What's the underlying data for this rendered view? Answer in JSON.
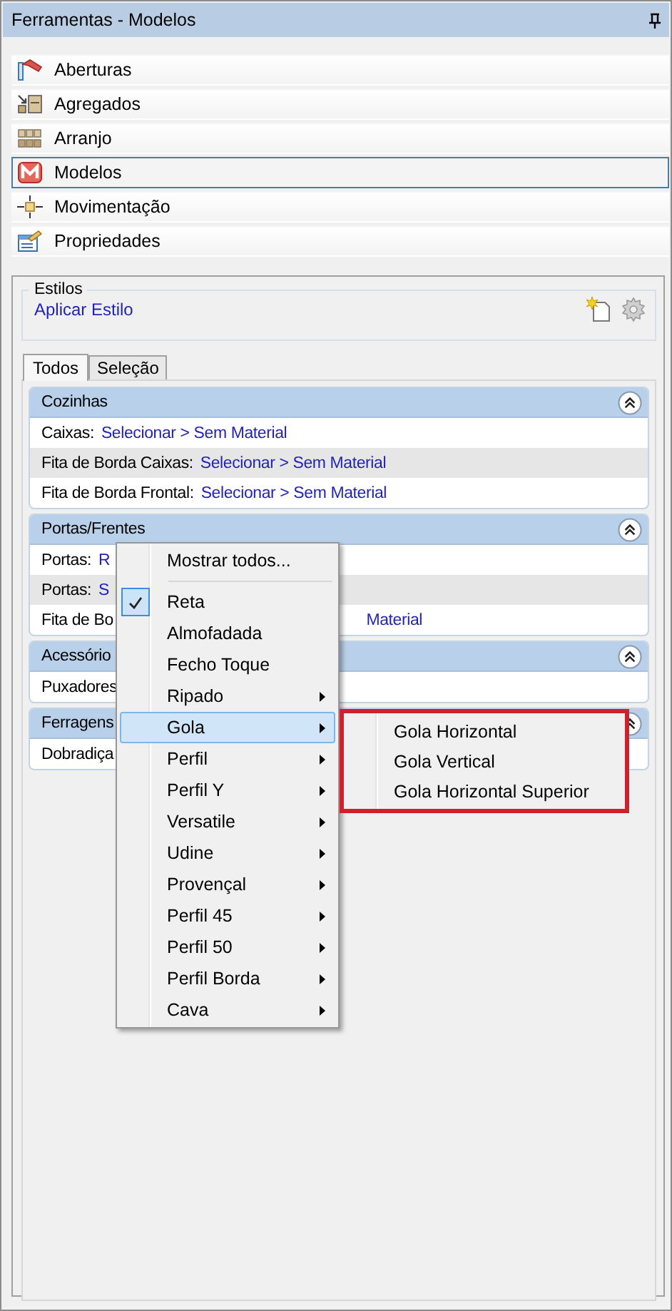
{
  "window": {
    "title": "Ferramentas - Modelos"
  },
  "nav": [
    {
      "label": "Aberturas",
      "selected": false
    },
    {
      "label": "Agregados",
      "selected": false
    },
    {
      "label": "Arranjo",
      "selected": false
    },
    {
      "label": "Modelos",
      "selected": true
    },
    {
      "label": "Movimentação",
      "selected": false
    },
    {
      "label": "Propriedades",
      "selected": false
    }
  ],
  "styles_group": {
    "legend": "Estilos",
    "link": "Aplicar Estilo"
  },
  "tabs": [
    {
      "label": "Todos",
      "selected": true
    },
    {
      "label": "Seleção",
      "selected": false
    }
  ],
  "sections": [
    {
      "title": "Cozinhas",
      "expanded": true,
      "rows": [
        {
          "kind": "full",
          "label": "Caixas:",
          "value": "Selecionar > Sem Material"
        },
        {
          "kind": "full",
          "label": "Fita de Borda Caixas:",
          "value": "Selecionar > Sem Material"
        },
        {
          "kind": "full",
          "label": "Fita de Borda Frontal:",
          "value": "Selecionar > Sem Material"
        }
      ]
    },
    {
      "title": "Portas/Frentes",
      "expanded": true,
      "rows": [
        {
          "kind": "full",
          "label": "Portas:",
          "value": "R"
        },
        {
          "kind": "full",
          "label": "Portas:",
          "value": "S"
        },
        {
          "kind": "tail",
          "label": "Fita de Bo",
          "value": "Material"
        }
      ]
    },
    {
      "title": "Acessório",
      "expanded": true,
      "rows": [
        {
          "kind": "full",
          "label": "Puxadores"
        }
      ]
    },
    {
      "title": "Ferragens",
      "expanded": true,
      "rows": [
        {
          "kind": "full",
          "label": "Dobradiça"
        }
      ]
    }
  ],
  "context_menu": {
    "items": [
      {
        "kind": "item",
        "label": "Mostrar todos...",
        "checked": false,
        "selected": false,
        "submenu": false
      },
      {
        "kind": "separator"
      },
      {
        "kind": "item",
        "label": "Reta",
        "checked": true,
        "selected": false,
        "submenu": false
      },
      {
        "kind": "item",
        "label": "Almofadada",
        "checked": false,
        "selected": false,
        "submenu": false
      },
      {
        "kind": "item",
        "label": "Fecho Toque",
        "checked": false,
        "selected": false,
        "submenu": false
      },
      {
        "kind": "item",
        "label": "Ripado",
        "checked": false,
        "selected": false,
        "submenu": true
      },
      {
        "kind": "item",
        "label": "Gola",
        "checked": false,
        "selected": true,
        "submenu": true
      },
      {
        "kind": "item",
        "label": "Perfil",
        "checked": false,
        "selected": false,
        "submenu": true
      },
      {
        "kind": "item",
        "label": "Perfil Y",
        "checked": false,
        "selected": false,
        "submenu": true
      },
      {
        "kind": "item",
        "label": "Versatile",
        "checked": false,
        "selected": false,
        "submenu": true
      },
      {
        "kind": "item",
        "label": "Udine",
        "checked": false,
        "selected": false,
        "submenu": true
      },
      {
        "kind": "item",
        "label": "Provençal",
        "checked": false,
        "selected": false,
        "submenu": true
      },
      {
        "kind": "item",
        "label": "Perfil 45",
        "checked": false,
        "selected": false,
        "submenu": true
      },
      {
        "kind": "item",
        "label": "Perfil 50",
        "checked": false,
        "selected": false,
        "submenu": true
      },
      {
        "kind": "item",
        "label": "Perfil Borda",
        "checked": false,
        "selected": false,
        "submenu": true
      },
      {
        "kind": "item",
        "label": "Cava",
        "checked": false,
        "selected": false,
        "submenu": true
      }
    ]
  },
  "submenu": {
    "items": [
      {
        "kind": "item",
        "label": "Gola Horizontal",
        "checked": false,
        "selected": false,
        "submenu": false
      },
      {
        "kind": "item",
        "label": "Gola Vertical",
        "checked": false,
        "selected": false,
        "submenu": false
      },
      {
        "kind": "item",
        "label": "Gola Horizontal Superior",
        "checked": false,
        "selected": false,
        "submenu": false
      }
    ]
  }
}
